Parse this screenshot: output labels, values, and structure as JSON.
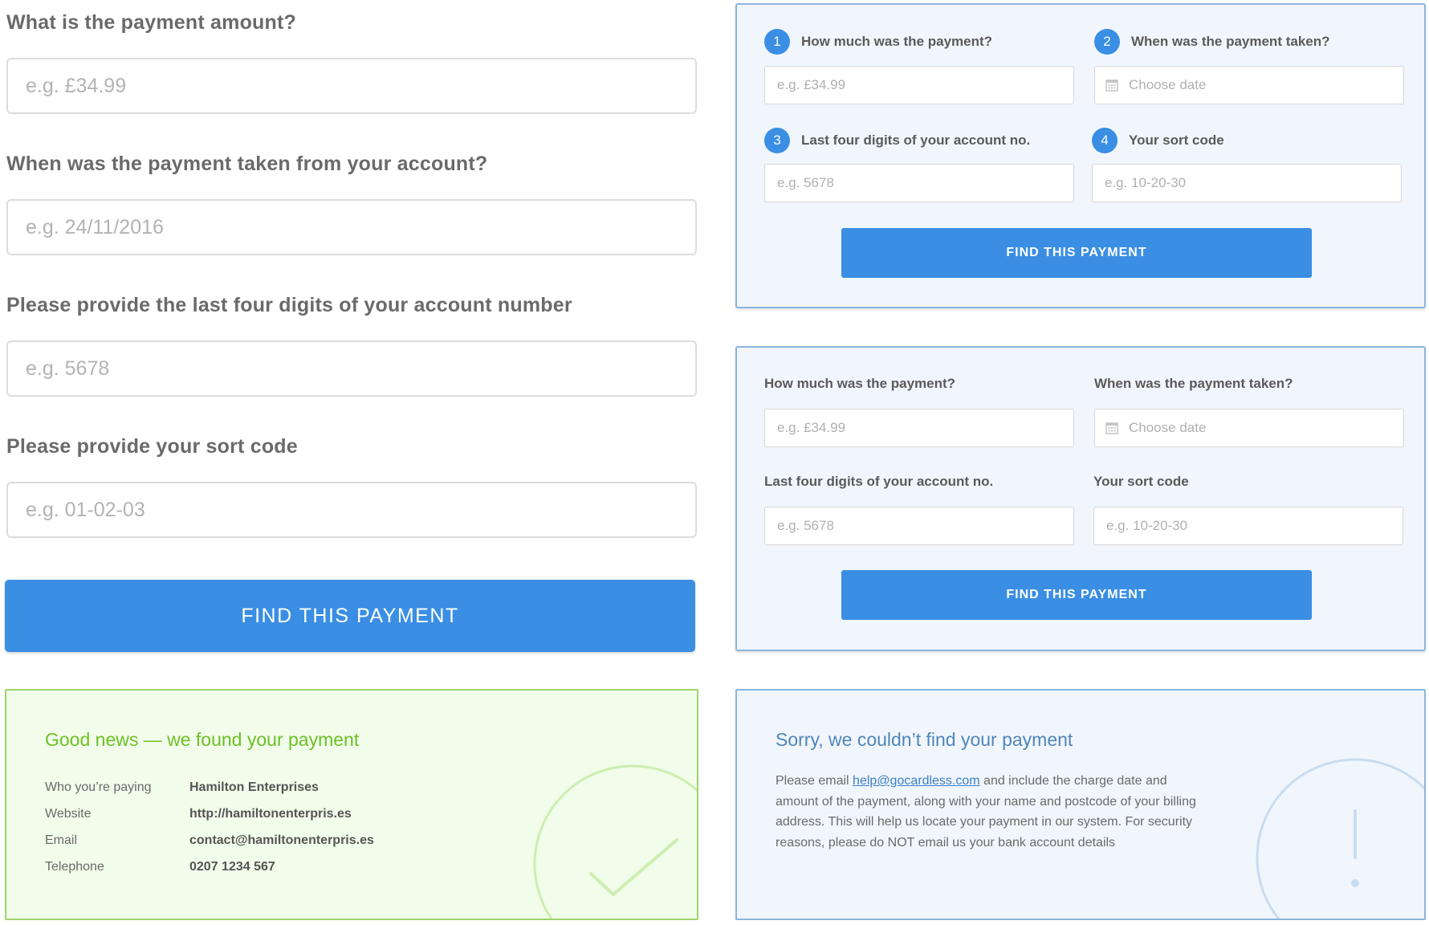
{
  "long_form": {
    "amount_label": "What is the payment amount?",
    "amount_placeholder": "e.g. £34.99",
    "date_label": "When was the payment taken from your account?",
    "date_placeholder": "e.g. 24/11/2016",
    "account_label": "Please provide the last four digits of your account number",
    "account_placeholder": "e.g. 5678",
    "sortcode_label": "Please provide your sort code",
    "sortcode_placeholder": "e.g. 01-02-03",
    "button_label": "FIND THIS PAYMENT"
  },
  "numbered_form": {
    "step1": "1",
    "step2": "2",
    "step3": "3",
    "step4": "4",
    "amount_label": "How much was the payment?",
    "amount_placeholder": "e.g. £34.99",
    "date_label": "When was the payment taken?",
    "date_placeholder": "Choose date",
    "account_label": "Last four digits of your account no.",
    "account_placeholder": "e.g. 5678",
    "sortcode_label": "Your sort code",
    "sortcode_placeholder": "e.g. 10-20-30",
    "button_label": "FIND THIS PAYMENT"
  },
  "plain_form": {
    "amount_label": "How much was the payment?",
    "amount_placeholder": "e.g. £34.99",
    "date_label": "When was the payment taken?",
    "date_placeholder": "Choose date",
    "account_label": "Last four digits of your account no.",
    "account_placeholder": "e.g. 5678",
    "sortcode_label": "Your sort code",
    "sortcode_placeholder": "e.g. 10-20-30",
    "button_label": "FIND THIS PAYMENT"
  },
  "success": {
    "title": "Good news — we found your payment",
    "rows": [
      {
        "key": "Who you’re paying",
        "value": "Hamilton Enterprises"
      },
      {
        "key": "Website",
        "value": "http://hamiltonenterpris.es"
      },
      {
        "key": "Email",
        "value": "contact@hamiltonenterpris.es"
      },
      {
        "key": "Telephone",
        "value": "0207 1234 567"
      }
    ]
  },
  "failure": {
    "title": "Sorry, we couldn’t find your payment",
    "text_before": "Please email ",
    "email_link": "help@gocardless.com",
    "text_after": " and include the charge date and amount of the payment, along with your name and postcode of your billing address. This will help us locate your payment in our system. For security reasons, please do NOT email us your bank account details"
  },
  "colors": {
    "primary_blue": "#3a8ee3",
    "panel_bg": "#f1f6fd",
    "success_green": "#6ec027",
    "success_bg": "#f1fcea"
  },
  "icons": [
    "calendar-icon",
    "checkmark-icon",
    "exclamation-icon"
  ]
}
